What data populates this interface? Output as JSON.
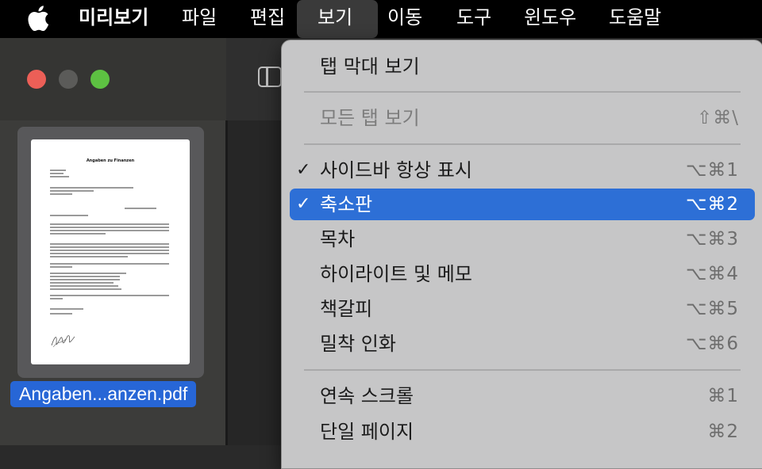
{
  "menubar": {
    "apple_icon": "apple-logo-icon",
    "items": [
      {
        "label": "미리보기",
        "bold": true
      },
      {
        "label": "파일"
      },
      {
        "label": "편집"
      },
      {
        "label": "보기",
        "active": true
      },
      {
        "label": "이동"
      },
      {
        "label": "도구"
      },
      {
        "label": "윈도우"
      },
      {
        "label": "도움말"
      }
    ]
  },
  "sidebar": {
    "thumbnail": {
      "title": "Angaben zu Finanzen"
    },
    "file_name": "Angaben...anzen.pdf"
  },
  "view_menu": {
    "items": [
      {
        "label": "탭 막대 보기",
        "shortcut": "",
        "checked": false,
        "disabled": false,
        "selected": false
      },
      {
        "label": "모든 탭 보기",
        "shortcut": "⇧⌘\\",
        "checked": false,
        "disabled": true,
        "selected": false
      },
      {
        "label": "사이드바 항상 표시",
        "shortcut": "⌥⌘1",
        "checked": true,
        "disabled": false,
        "selected": false
      },
      {
        "label": "축소판",
        "shortcut": "⌥⌘2",
        "checked": true,
        "disabled": false,
        "selected": true
      },
      {
        "label": "목차",
        "shortcut": "⌥⌘3",
        "checked": false,
        "disabled": false,
        "selected": false
      },
      {
        "label": "하이라이트 및 메모",
        "shortcut": "⌥⌘4",
        "checked": false,
        "disabled": false,
        "selected": false
      },
      {
        "label": "책갈피",
        "shortcut": "⌥⌘5",
        "checked": false,
        "disabled": false,
        "selected": false
      },
      {
        "label": "밀착 인화",
        "shortcut": "⌥⌘6",
        "checked": false,
        "disabled": false,
        "selected": false
      },
      {
        "label": "연속 스크롤",
        "shortcut": "⌘1",
        "checked": false,
        "disabled": false,
        "selected": false
      },
      {
        "label": "단일 페이지",
        "shortcut": "⌘2",
        "checked": false,
        "disabled": false,
        "selected": false
      }
    ],
    "check_glyph": "✓"
  },
  "colors": {
    "selection": "#2d6fd6",
    "menu_bg": "#c6c6c7",
    "traffic_red": "#ec5f57",
    "traffic_green": "#5dc142"
  }
}
